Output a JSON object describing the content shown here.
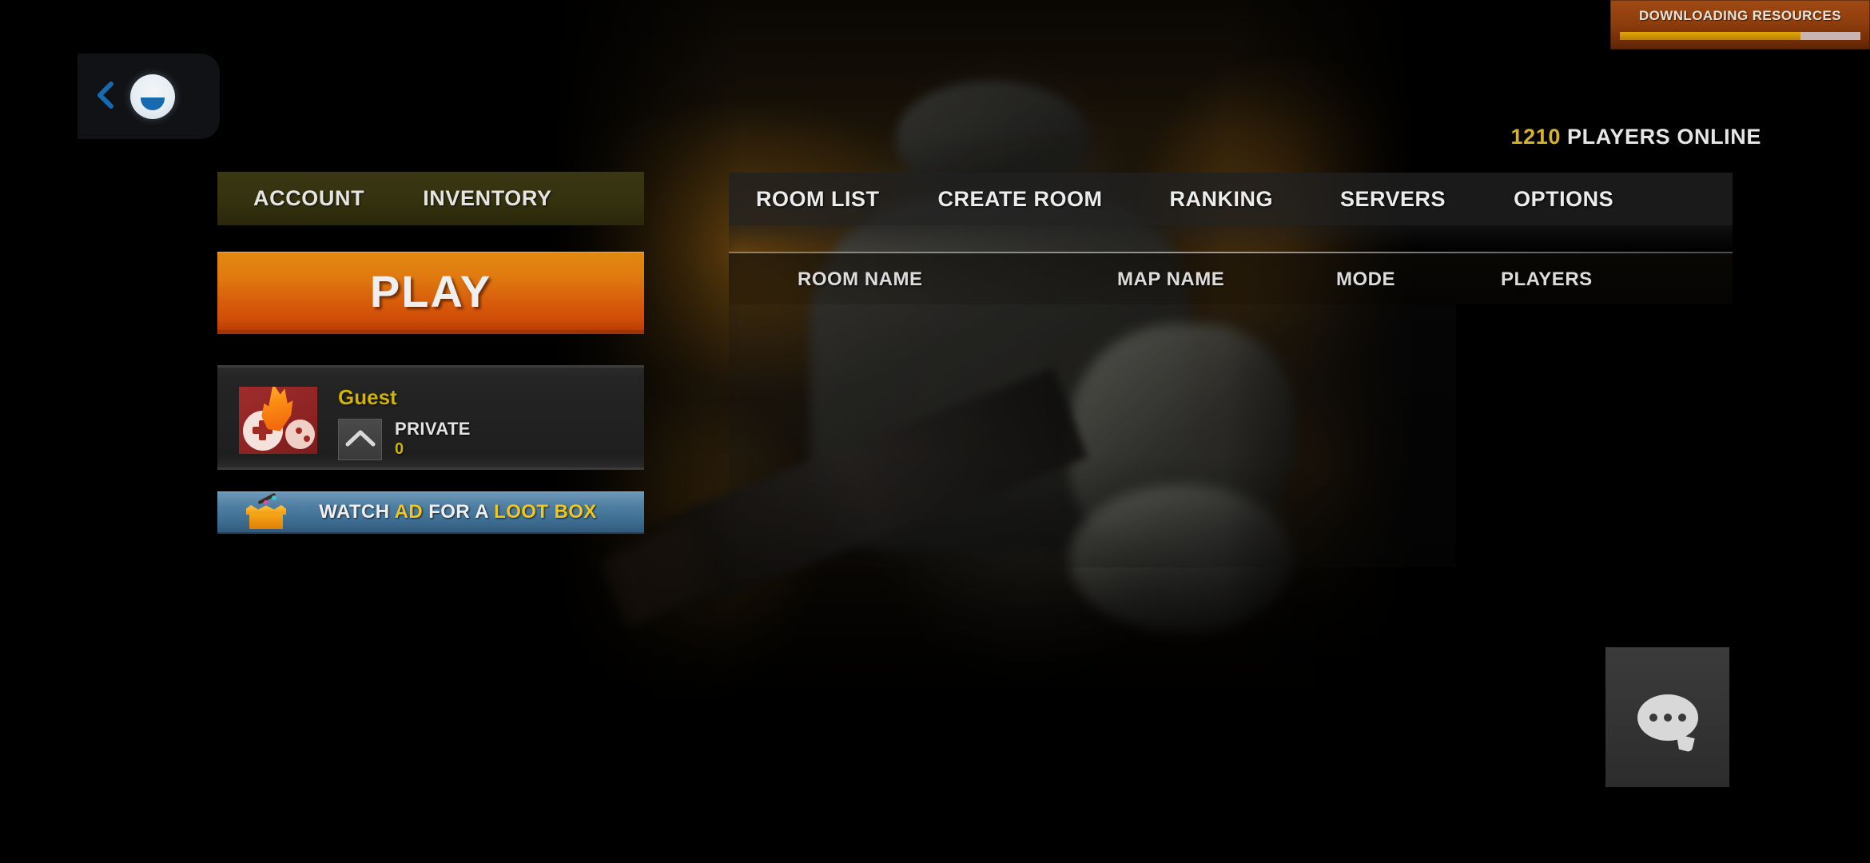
{
  "download_banner": {
    "label": "DOWNLOADING RESOURCES",
    "progress_percent": 75,
    "fill_color": "#d39a05",
    "track_color": "#c9b4b4",
    "background_color": "#8e3d0d"
  },
  "topbar": {
    "back_icon": "chevron-left-icon",
    "back_icon_color": "#1769b0",
    "avatar_icon": "smiley-avatar-icon"
  },
  "status": {
    "players_count": "1210",
    "players_label": "PLAYERS ONLINE",
    "count_color": "#d8b22a"
  },
  "left_panel": {
    "tabs": [
      {
        "label": "ACCOUNT"
      },
      {
        "label": "INVENTORY"
      }
    ],
    "play_button": {
      "label": "PLAY",
      "color": "#e07a10"
    },
    "profile": {
      "avatar_icon": "flame-controller-avatar-icon",
      "name": "Guest",
      "name_color": "#cfb307",
      "rank_icon": "chevron-up-rank-icon",
      "rank_label": "PRIVATE",
      "rank_level": "0",
      "level_color": "#d0b307"
    },
    "ad_button": {
      "icon": "loot-box-icon",
      "text_part_1": "WATCH ",
      "text_part_2": "AD",
      "text_part_3": " FOR A ",
      "text_part_4": "LOOT BOX",
      "highlight_color": "#f0c71e",
      "background_color": "#4e7ea2"
    }
  },
  "right_panel": {
    "nav_tabs": [
      {
        "label": "ROOM LIST"
      },
      {
        "label": "CREATE ROOM"
      },
      {
        "label": "RANKING"
      },
      {
        "label": "SERVERS"
      },
      {
        "label": "OPTIONS"
      }
    ],
    "table": {
      "columns": [
        {
          "label": "ROOM NAME"
        },
        {
          "label": "MAP NAME"
        },
        {
          "label": "MODE"
        },
        {
          "label": "PLAYERS"
        }
      ],
      "rows": []
    }
  },
  "chat_button": {
    "icon": "chat-bubble-icon"
  }
}
